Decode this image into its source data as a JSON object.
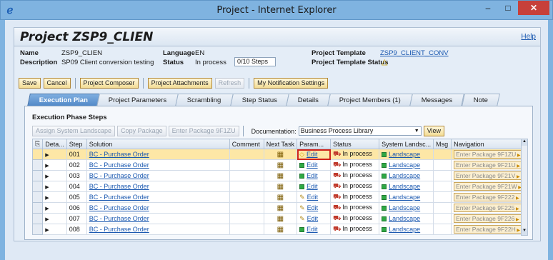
{
  "window": {
    "title": "Project - Internet Explorer",
    "ie_icon": "ℯ",
    "minimize": "–",
    "maximize": "□",
    "close": "✕"
  },
  "page": {
    "title": "Project ZSP9_CLIEN",
    "help": "Help",
    "info": {
      "name_label": "Name",
      "name_value": "ZSP9_CLIEN",
      "language_label": "Language",
      "language_value": "EN",
      "project_template_label": "Project Template",
      "project_template_value": "ZSP9_CLIENT_CONV",
      "description_label": "Description",
      "description_value": "SP09 Client conversion testing",
      "status_label": "Status",
      "status_value": "In process",
      "steps_value": "0/10 Steps",
      "template_status_label": "Project Template Status"
    },
    "toolbar": [
      "Save",
      "Cancel",
      "Project Composer",
      "Project Attachments",
      "Refresh",
      "My Notification Settings"
    ],
    "tabs": [
      "Execution Plan",
      "Project Parameters",
      "Scrambling",
      "Step Status",
      "Details",
      "Project Members (1)",
      "Messages",
      "Note"
    ],
    "section_title": "Execution Phase Steps",
    "grid_toolbar": {
      "assign": "Assign System Landscape",
      "copy": "Copy Package",
      "enter": "Enter Package 9F1ZU",
      "doc_label": "Documentation:",
      "doc_value": "Business Process Library",
      "view": "View"
    },
    "columns": [
      "Deta...",
      "Step",
      "Solution",
      "Comment",
      "Next Task",
      "Param...",
      "Status",
      "System Landsc...",
      "Msg",
      "Navigation"
    ],
    "rows": [
      {
        "step": "001",
        "solution": "BC - Purchase Order",
        "param": "Edit",
        "status": "In process",
        "landscape": "Landscape",
        "nav": "Enter Package 9F1ZU"
      },
      {
        "step": "002",
        "solution": "BC - Purchase Order",
        "param": "Edit",
        "status": "In process",
        "landscape": "Landscape",
        "nav": "Enter Package 9F21U"
      },
      {
        "step": "003",
        "solution": "BC - Purchase Order",
        "param": "Edit",
        "status": "In process",
        "landscape": "Landscape",
        "nav": "Enter Package 9F21V"
      },
      {
        "step": "004",
        "solution": "BC - Purchase Order",
        "param": "Edit",
        "status": "In process",
        "landscape": "Landscape",
        "nav": "Enter Package 9F21W"
      },
      {
        "step": "005",
        "solution": "BC - Purchase Order",
        "param": "Edit",
        "status": "In process",
        "landscape": "Landscape",
        "nav": "Enter Package 9F222"
      },
      {
        "step": "006",
        "solution": "BC - Purchase Order",
        "param": "Edit",
        "status": "In process",
        "landscape": "Landscape",
        "nav": "Enter Package 9F225"
      },
      {
        "step": "007",
        "solution": "BC - Purchase Order",
        "param": "Edit",
        "status": "In process",
        "landscape": "Landscape",
        "nav": "Enter Package 9F226"
      },
      {
        "step": "008",
        "solution": "BC - Purchase Order",
        "param": "Edit",
        "status": "In process",
        "landscape": "Landscape",
        "nav": "Enter Package 9F22H"
      }
    ]
  }
}
